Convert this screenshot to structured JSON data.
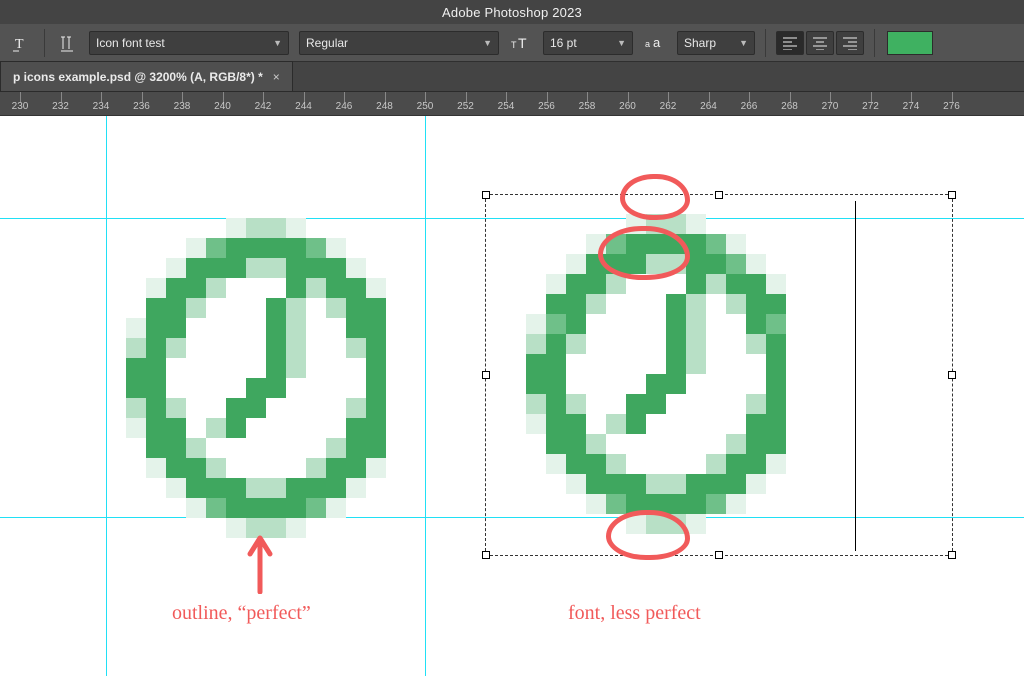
{
  "app_title": "Adobe Photoshop 2023",
  "toolbar": {
    "font_family": "Icon font test",
    "font_style": "Regular",
    "font_size": "16 pt",
    "aa_label": "Sharp",
    "swatch_color": "#3fb161"
  },
  "document": {
    "tab_title": "p icons example.psd @ 3200% (A, RGB/8*) *"
  },
  "ruler_ticks": [
    230,
    232,
    234,
    236,
    238,
    240,
    242,
    244,
    246,
    248,
    250,
    252,
    254,
    256,
    258,
    260,
    262,
    264,
    266,
    268,
    270,
    272,
    274,
    276
  ],
  "annotations": {
    "left_label": "outline, “perfect”",
    "right_label": "font, less perfect"
  },
  "colors": {
    "green_dark": "#3fa75f",
    "green_mid": "#6fc089",
    "green_light": "#b8e0c6",
    "green_pale": "#e4f3ea"
  },
  "icon_bitmap": [
    "................",
    "......1221......",
    "....13444431....",
    "...1444224441...",
    "..144200042441..",
    "..442000420244..",
    ".1440000420044..",
    ".2420000420024..",
    ".4400000420004..",
    ".4400004400004..",
    ".2420044000024..",
    ".1440240000044..",
    "..442000000244..",
    "..144200002441..",
    "...1444224441...",
    "....13444431....",
    "......1221......"
  ]
}
